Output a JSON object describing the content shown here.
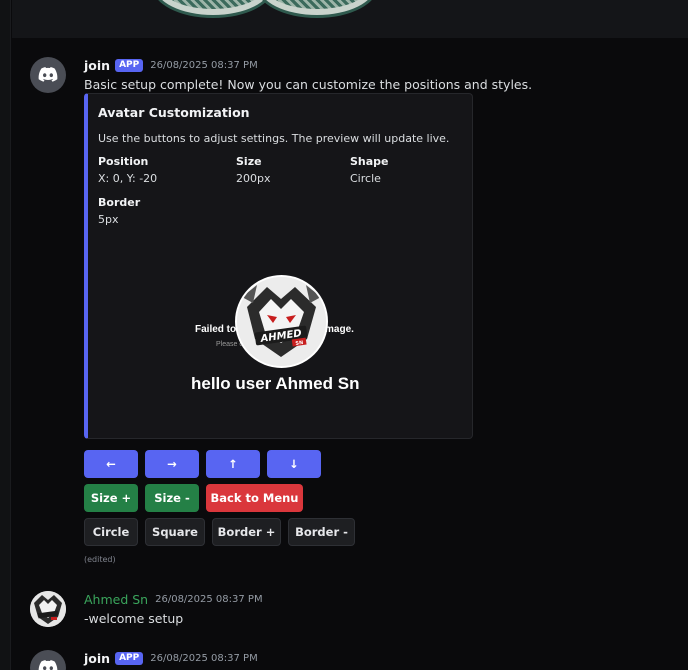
{
  "messages": [
    {
      "author": "join",
      "tag": "APP",
      "timestamp": "26/08/2025 08:37 PM",
      "content": "Basic setup complete! Now you can customize the positions and styles.",
      "embed": {
        "title": "Avatar Customization",
        "description": "Use the buttons to adjust settings. The preview will update live.",
        "fields": [
          {
            "name": "Position",
            "value": "X: 0, Y: -20"
          },
          {
            "name": "Size",
            "value": "200px"
          },
          {
            "name": "Shape",
            "value": "Circle"
          },
          {
            "name": "Border",
            "value": "5px"
          }
        ],
        "preview": {
          "error_title": "Failed to load background image.",
          "error_hint": "Please check the image link",
          "greeting": "hello user Ahmed Sn",
          "avatar_text": "AHMED",
          "avatar_subtext": "SN"
        }
      },
      "buttons": {
        "left": "←",
        "right": "→",
        "up": "↑",
        "down": "↓",
        "size_plus": "Size +",
        "size_minus": "Size -",
        "back": "Back to Menu",
        "circle": "Circle",
        "square": "Square",
        "border_plus": "Border +",
        "border_minus": "Border -"
      },
      "edited": "(edited)"
    },
    {
      "author": "Ahmed Sn",
      "timestamp": "26/08/2025 08:37 PM",
      "content": "-welcome setup"
    },
    {
      "author": "join",
      "tag": "APP",
      "timestamp": "26/08/2025 08:37 PM"
    }
  ],
  "colors": {
    "blurple": "#5865f2",
    "success": "#248046",
    "danger": "#da373c",
    "user_name": "#3aa55c"
  },
  "icons": {
    "bot_avatar": "discord-logo-icon",
    "user_avatar": "wolf-logo-icon"
  }
}
